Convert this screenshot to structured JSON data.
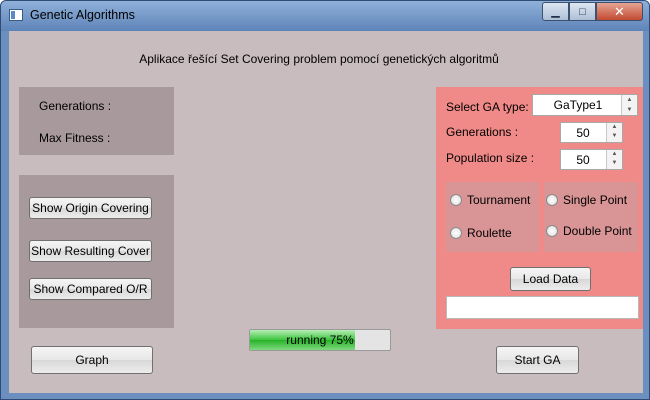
{
  "window": {
    "title": "Genetic Algorithms"
  },
  "heading": "Aplikace řešící Set Covering problem pomocí genetických algoritmů",
  "stats": {
    "generations_label": "Generations :",
    "max_fitness_label": "Max Fitness :"
  },
  "buttons": {
    "show_origin": "Show Origin Covering",
    "show_resulting": "Show Resulting Cover",
    "show_compared": "Show Compared O/R",
    "graph": "Graph",
    "start_ga": "Start GA",
    "load_data": "Load Data"
  },
  "settings": {
    "ga_type_label": "Select GA type:",
    "ga_type_value": "GaType1",
    "generations_label": "Generations :",
    "generations_value": "50",
    "population_label": "Population size :",
    "population_value": "50"
  },
  "selection": {
    "options": [
      "Tournament",
      "Roulette"
    ]
  },
  "crossover": {
    "options": [
      "Single Point",
      "Double Point"
    ]
  },
  "output_text": "",
  "progress": {
    "value": 0.75,
    "text": "running 75%"
  },
  "colors": {
    "client_bg": "#c8bcbe",
    "panel_gray": "#a89a9c",
    "panel_right": "#f08a88",
    "progress_green": "#3cc53c"
  }
}
